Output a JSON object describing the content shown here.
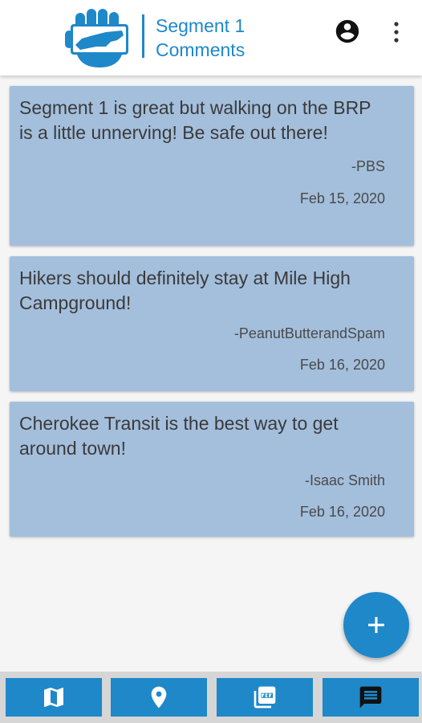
{
  "header": {
    "title_line1": "Segment 1",
    "title_line2": "Comments",
    "logo_icon": "nc-map-hand-logo",
    "account_icon": "account-circle-icon",
    "menu_icon": "more-vert-icon"
  },
  "comments": [
    {
      "text": "Segment 1 is great but walking on the BRP is a little unnerving!  Be safe out there!",
      "author": "-PBS",
      "date": "Feb 15, 2020"
    },
    {
      "text": "Hikers should definitely stay at Mile High Campground!",
      "author": "-PeanutButterandSpam",
      "date": "Feb 16, 2020"
    },
    {
      "text": "Cherokee Transit is the best way to get around town!",
      "author": "-Isaac Smith",
      "date": "Feb 16, 2020"
    }
  ],
  "fab": {
    "icon": "plus-icon"
  },
  "bottom_nav": [
    {
      "icon": "map-icon",
      "active": false
    },
    {
      "icon": "location-pin-icon",
      "active": false
    },
    {
      "icon": "pdf-icon",
      "active": false
    },
    {
      "icon": "comment-icon",
      "active": true
    }
  ],
  "colors": {
    "accent": "#1e88c9",
    "card": "#a4bfdc",
    "background": "#f5f5f5",
    "active_icon": "#111111",
    "inactive_icon": "#ffffff"
  }
}
